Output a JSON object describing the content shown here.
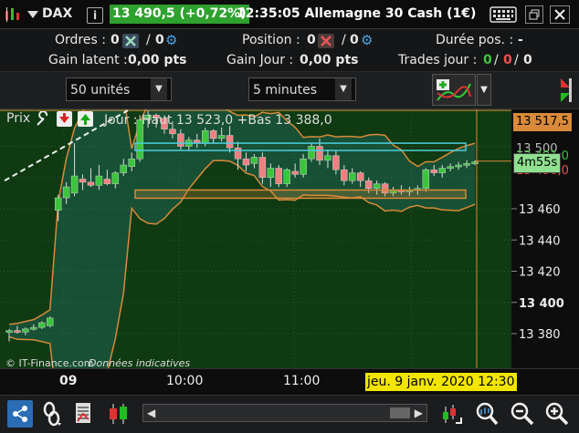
{
  "title": {
    "symbol": "DAX",
    "price_change": "13 490,5 (+0,72%)",
    "time_and_name": "12:35:05 Allemagne 30 Cash (1€)"
  },
  "info": {
    "orders_label": "Ordres :",
    "orders_value": "0",
    "orders_sep": "/",
    "orders_value2": "0",
    "position_label": "Position :",
    "position_value": "0",
    "position_sep": "/",
    "position_value2": "0",
    "duration_label": "Durée pos. :",
    "duration_value": "-",
    "latent_label": "Gain latent :",
    "latent_value": "0,00 pts",
    "day_label": "Gain Jour :",
    "day_value": "0,00 pts",
    "trades_label": "Trades jour :",
    "trades_a": "0",
    "trades_b": "0",
    "trades_c": "0",
    "trades_sep": "/"
  },
  "controls": {
    "quantity": "50 unités",
    "timeframe": "5 minutes"
  },
  "chart": {
    "price_label": "Prix",
    "legend": "Jour : Haut 13 523,0 +Bas 13 388,0",
    "copyright": "© IT-Finance.com",
    "indicative": "Données indicatives",
    "y_ticks": [
      {
        "price": 13460,
        "label": "13 460"
      },
      {
        "price": 13440,
        "label": "13 440"
      },
      {
        "price": 13420,
        "label": "13 420"
      },
      {
        "price": 13400,
        "label": "13 400"
      },
      {
        "price": 13380,
        "label": "13 380"
      }
    ],
    "x_labels": [
      "09",
      "10:00",
      "11:00"
    ],
    "cursor_date": "jeu. 9 janv. 2020 12:30",
    "high_tag": "13 517,5",
    "timer_tag": "4m55s",
    "partial_tags": [
      "13 500",
      "13 491,0",
      "13 490,0"
    ],
    "colors": {
      "up": "#3dc43d",
      "down": "#f08080",
      "band": "#2d8c8c",
      "background": "#0f3a12",
      "orange": "#d88a3a"
    }
  },
  "chart_data": {
    "type": "candlestick",
    "y_unit": "points",
    "ylim": [
      13368,
      13530
    ],
    "day_high": 13523.0,
    "day_low": 13388.0,
    "last": 13490.5,
    "candles": [
      {
        "o": 13381,
        "h": 13383,
        "l": 13375,
        "c": 13382
      },
      {
        "o": 13382,
        "h": 13385,
        "l": 13380,
        "c": 13381
      },
      {
        "o": 13381,
        "h": 13384,
        "l": 13379,
        "c": 13383
      },
      {
        "o": 13383,
        "h": 13386,
        "l": 13382,
        "c": 13384
      },
      {
        "o": 13384,
        "h": 13388,
        "l": 13383,
        "c": 13387
      },
      {
        "o": 13385,
        "h": 13391,
        "l": 13384,
        "c": 13390
      },
      {
        "o": 13459,
        "h": 13469,
        "l": 13452,
        "c": 13467
      },
      {
        "o": 13467,
        "h": 13477,
        "l": 13463,
        "c": 13474
      },
      {
        "o": 13470,
        "h": 13502,
        "l": 13468,
        "c": 13481
      },
      {
        "o": 13479,
        "h": 13482,
        "l": 13472,
        "c": 13477
      },
      {
        "o": 13477,
        "h": 13486,
        "l": 13474,
        "c": 13475
      },
      {
        "o": 13475,
        "h": 13488,
        "l": 13472,
        "c": 13481
      },
      {
        "o": 13479,
        "h": 13485,
        "l": 13475,
        "c": 13476
      },
      {
        "o": 13476,
        "h": 13484,
        "l": 13473,
        "c": 13483
      },
      {
        "o": 13483,
        "h": 13492,
        "l": 13481,
        "c": 13488
      },
      {
        "o": 13487,
        "h": 13496,
        "l": 13484,
        "c": 13492
      },
      {
        "o": 13492,
        "h": 13520,
        "l": 13490,
        "c": 13517
      },
      {
        "o": 13517,
        "h": 13523,
        "l": 13512,
        "c": 13520
      },
      {
        "o": 13520,
        "h": 13521,
        "l": 13512,
        "c": 13518
      },
      {
        "o": 13518,
        "h": 13520,
        "l": 13508,
        "c": 13511
      },
      {
        "o": 13511,
        "h": 13516,
        "l": 13505,
        "c": 13508
      },
      {
        "o": 13508,
        "h": 13511,
        "l": 13498,
        "c": 13500
      },
      {
        "o": 13500,
        "h": 13506,
        "l": 13497,
        "c": 13504
      },
      {
        "o": 13504,
        "h": 13508,
        "l": 13499,
        "c": 13502
      },
      {
        "o": 13502,
        "h": 13512,
        "l": 13500,
        "c": 13510
      },
      {
        "o": 13510,
        "h": 13511,
        "l": 13502,
        "c": 13505
      },
      {
        "o": 13505,
        "h": 13512,
        "l": 13503,
        "c": 13507
      },
      {
        "o": 13507,
        "h": 13513,
        "l": 13496,
        "c": 13499
      },
      {
        "o": 13499,
        "h": 13503,
        "l": 13485,
        "c": 13492
      },
      {
        "o": 13492,
        "h": 13496,
        "l": 13484,
        "c": 13488
      },
      {
        "o": 13489,
        "h": 13495,
        "l": 13486,
        "c": 13493
      },
      {
        "o": 13493,
        "h": 13496,
        "l": 13476,
        "c": 13480
      },
      {
        "o": 13480,
        "h": 13489,
        "l": 13474,
        "c": 13486
      },
      {
        "o": 13486,
        "h": 13488,
        "l": 13474,
        "c": 13476
      },
      {
        "o": 13476,
        "h": 13486,
        "l": 13474,
        "c": 13485
      },
      {
        "o": 13484,
        "h": 13489,
        "l": 13480,
        "c": 13482
      },
      {
        "o": 13482,
        "h": 13495,
        "l": 13480,
        "c": 13492
      },
      {
        "o": 13492,
        "h": 13502,
        "l": 13490,
        "c": 13500
      },
      {
        "o": 13500,
        "h": 13505,
        "l": 13488,
        "c": 13491
      },
      {
        "o": 13491,
        "h": 13498,
        "l": 13486,
        "c": 13494
      },
      {
        "o": 13494,
        "h": 13497,
        "l": 13482,
        "c": 13485
      },
      {
        "o": 13485,
        "h": 13488,
        "l": 13475,
        "c": 13478
      },
      {
        "o": 13478,
        "h": 13486,
        "l": 13476,
        "c": 13483
      },
      {
        "o": 13483,
        "h": 13484,
        "l": 13474,
        "c": 13478
      },
      {
        "o": 13478,
        "h": 13480,
        "l": 13470,
        "c": 13473
      },
      {
        "o": 13473,
        "h": 13478,
        "l": 13469,
        "c": 13476
      },
      {
        "o": 13476,
        "h": 13477,
        "l": 13468,
        "c": 13470
      },
      {
        "o": 13470,
        "h": 13474,
        "l": 13468,
        "c": 13472
      },
      {
        "o": 13472,
        "h": 13475,
        "l": 13469,
        "c": 13471
      },
      {
        "o": 13471,
        "h": 13474,
        "l": 13468,
        "c": 13472
      },
      {
        "o": 13472,
        "h": 13475,
        "l": 13469,
        "c": 13473
      },
      {
        "o": 13473,
        "h": 13486,
        "l": 13471,
        "c": 13485
      },
      {
        "o": 13485,
        "h": 13488,
        "l": 13481,
        "c": 13483
      },
      {
        "o": 13483,
        "h": 13488,
        "l": 13480,
        "c": 13486
      },
      {
        "o": 13486,
        "h": 13489,
        "l": 13484,
        "c": 13487
      },
      {
        "o": 13487,
        "h": 13490,
        "l": 13485,
        "c": 13488
      },
      {
        "o": 13488,
        "h": 13491,
        "l": 13486,
        "c": 13489
      },
      {
        "o": 13489,
        "h": 13491,
        "l": 13488,
        "c": 13490
      }
    ]
  }
}
